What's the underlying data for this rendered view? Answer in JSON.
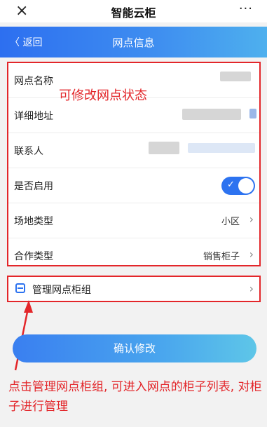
{
  "topbar": {
    "close_glyph": "×",
    "title": "智能云柜",
    "more_glyph": "···"
  },
  "navbar": {
    "back_label": "〈 返回",
    "title": "网点信息"
  },
  "form": {
    "rows": [
      {
        "label": "网点名称"
      },
      {
        "label": "详细地址"
      },
      {
        "label": "联系人"
      },
      {
        "label": "是否启用",
        "enabled": true
      },
      {
        "label": "场地类型",
        "value": "小区"
      },
      {
        "label": "合作类型",
        "value": "销售柜子"
      }
    ]
  },
  "manage": {
    "label": "管理网点柜组",
    "icon": "cabinet-icon"
  },
  "confirm_button": {
    "label": "确认修改"
  },
  "annotations": {
    "top": "可修改网点状态",
    "bottom": "点击管理网点柜组, 可进入网点的柜子列表, 对柜子进行管理"
  },
  "colors": {
    "accent": "#2d73f0",
    "annotation": "#e3262a"
  }
}
